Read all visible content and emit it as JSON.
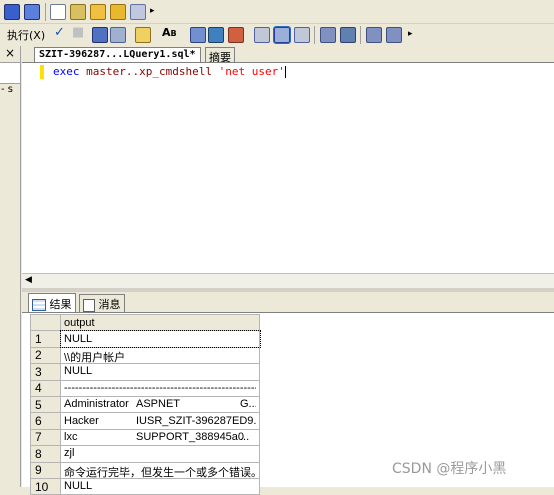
{
  "toolbar": {
    "execute_label": "执行(X)"
  },
  "editor": {
    "tab_title": "SZIT-396287...LQuery1.sql*",
    "tab_summary": "摘要",
    "query": {
      "keyword": "exec",
      "obj": "master..xp_cmdshell",
      "literal": "'net user'"
    }
  },
  "left_panel": {
    "label": "- s"
  },
  "results": {
    "tab_results": "结果",
    "tab_messages": "消息",
    "column_header": "output",
    "rows": [
      {
        "n": "1",
        "c1": "NULL",
        "c2": "",
        "c3": ""
      },
      {
        "n": "2",
        "c1": "\\\\的用户帐户",
        "c2": "",
        "c3": ""
      },
      {
        "n": "3",
        "c1": "NULL",
        "c2": "",
        "c3": ""
      },
      {
        "n": "4",
        "c1": "---------------------------------------------------------------...",
        "c2": "",
        "c3": ""
      },
      {
        "n": "5",
        "c1": "Administrator",
        "c2": "ASPNET",
        "c3": "G..."
      },
      {
        "n": "6",
        "c1": "Hacker",
        "c2": "IUSR_SZIT-396287ED9...",
        "c3": ""
      },
      {
        "n": "7",
        "c1": "lxc",
        "c2": "SUPPORT_388945a0",
        "c3": "..."
      },
      {
        "n": "8",
        "c1": "zjl",
        "c2": "",
        "c3": ""
      },
      {
        "n": "9",
        "c1": "命令运行完毕，但发生一个或多个错误。",
        "c2": "",
        "c3": ""
      },
      {
        "n": "10",
        "c1": "NULL",
        "c2": "",
        "c3": ""
      }
    ]
  },
  "watermark": "CSDN @程序小黑",
  "colors": {
    "keyword": "#0000ff",
    "object": "#8b0000",
    "string": "#ff0000",
    "selected_row": "#ffffff",
    "chrome": "#ece9d8"
  }
}
